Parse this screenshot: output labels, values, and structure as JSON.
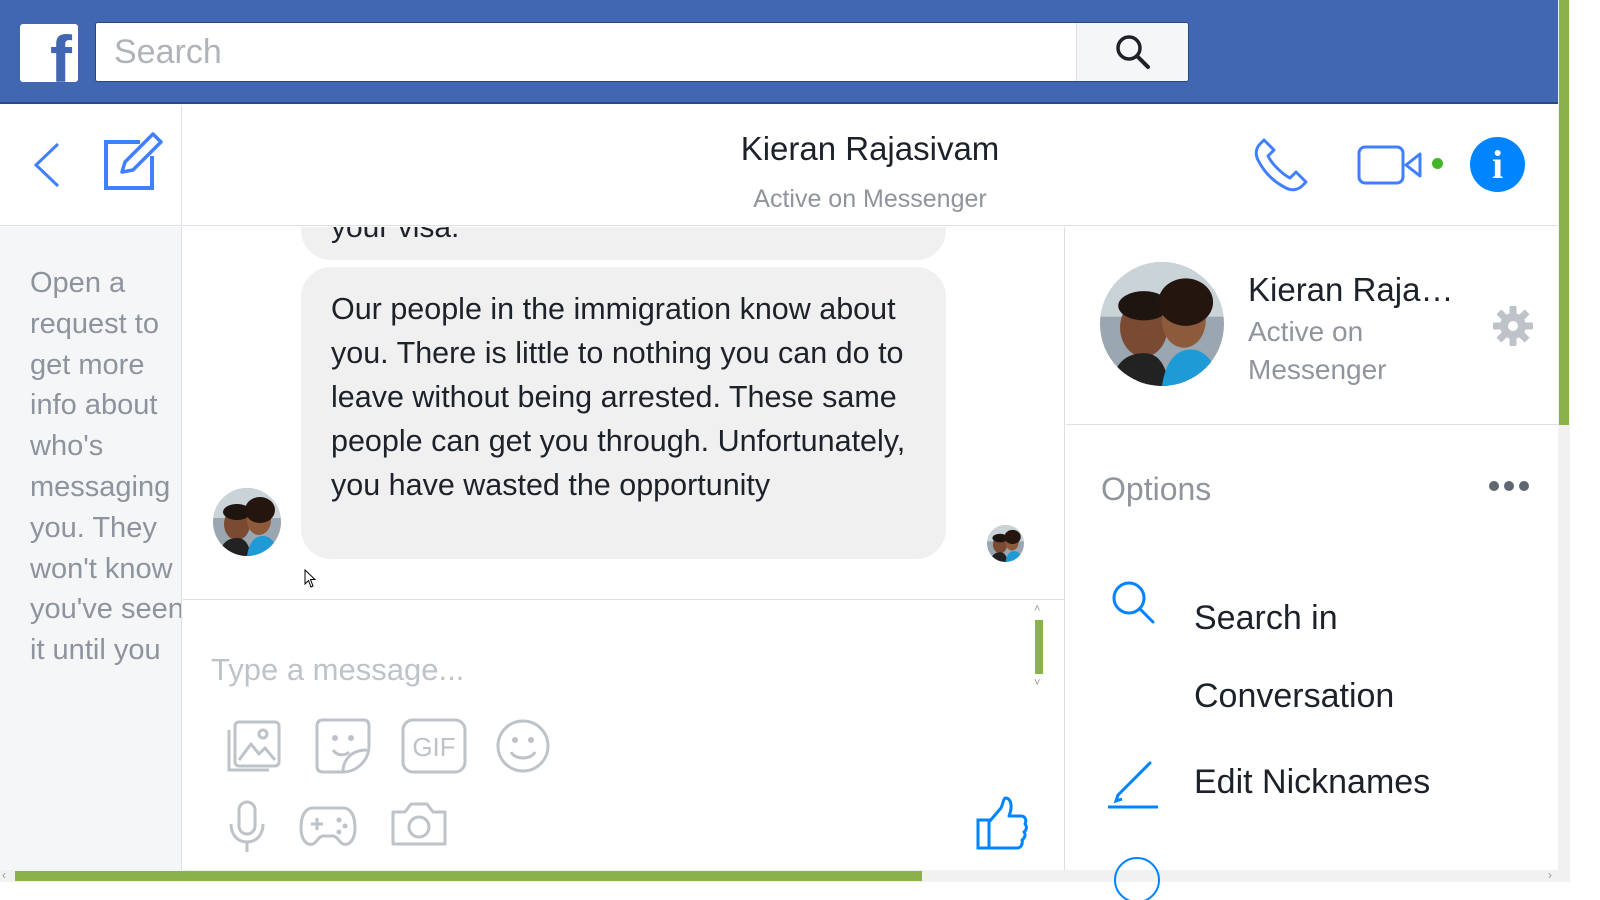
{
  "topbar": {
    "logo_letter": "f",
    "search_placeholder": "Search"
  },
  "nav": {
    "back_icon": "chevron-left-icon",
    "compose_icon": "compose-icon"
  },
  "sidebar": {
    "request_text": "Open a request to get more info about who's messaging you. They won't know you've seen it until you"
  },
  "conversation": {
    "name": "Kieran Rajasivam",
    "status": "Active on Messenger",
    "icons": [
      "phone-icon",
      "video-camera-icon",
      "info-icon"
    ],
    "active_color": "#42b72a",
    "accent_color": "#0084ff"
  },
  "messages": {
    "previous_fragment": "your visa.",
    "last_message": "Our people in the immigration know about you. There is little to nothing you can do to leave without being arrested. These same people can get you through. Unfortunately, you have wasted the opportunity"
  },
  "composer": {
    "placeholder": "Type a message...",
    "tools": [
      "photo-icon",
      "sticker-icon",
      "gif-icon",
      "emoji-icon",
      "microphone-icon",
      "game-controller-icon",
      "camera-icon",
      "thumbs-up-icon"
    ],
    "gif_label": "GIF"
  },
  "info_panel": {
    "name": "Kieran Rajasivam",
    "status": "Active on Messenger",
    "options_title": "Options",
    "options": [
      {
        "label": "Search in Conversation",
        "icon": "search-icon"
      },
      {
        "label": "Edit Nicknames",
        "icon": "pencil-icon"
      }
    ]
  },
  "colors": {
    "header_blue": "#4267b2",
    "scrollbar_green": "#8ab14a",
    "bubble_grey": "#f1f0f0"
  }
}
